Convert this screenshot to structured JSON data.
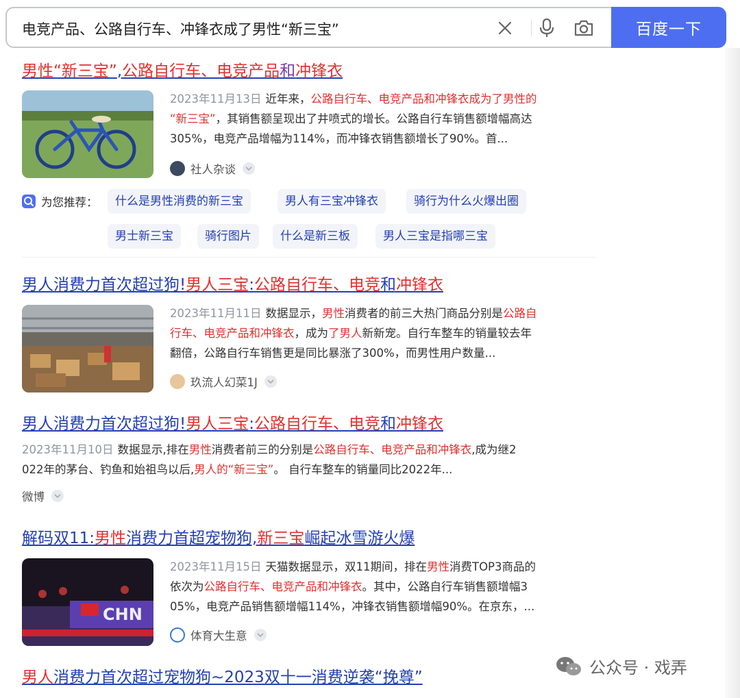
{
  "search": {
    "query": "电竞产品、公路自行车、冲锋衣成了男性“新三宝”",
    "button_label": "百度一下"
  },
  "results": [
    {
      "title_parts": [
        {
          "t": "男性“新三宝”",
          "c": "hl"
        },
        {
          "t": ",",
          "c": ""
        },
        {
          "t": "公路自行车、电竞产品",
          "c": "hl"
        },
        {
          "t": "和",
          "c": "vis"
        },
        {
          "t": "冲锋衣",
          "c": "hl"
        }
      ],
      "date": "2023年11月13日",
      "snippet_lines": [
        [
          {
            "t": "近年来，",
            "c": ""
          },
          {
            "t": "公路自行车、电竞产品和冲锋衣成为了男性的",
            "c": "hl"
          }
        ],
        [
          {
            "t": "“新三宝”",
            "c": "hl"
          },
          {
            "t": "，其销售额呈现出了井喷式的增长。公路自行车销售额增幅高达",
            "c": ""
          }
        ],
        [
          {
            "t": "305%，电竞产品增幅为114%，而冲锋衣销售额增长了90%。首...",
            "c": ""
          }
        ]
      ],
      "source": "社人杂谈"
    },
    {
      "title_parts": [
        {
          "t": "男人消费力首次超过狗!",
          "c": ""
        },
        {
          "t": "男人三宝",
          "c": "hl"
        },
        {
          "t": ":",
          "c": ""
        },
        {
          "t": "公路自行车、电竞",
          "c": "hl"
        },
        {
          "t": "和",
          "c": ""
        },
        {
          "t": "冲锋衣",
          "c": "hl"
        }
      ],
      "date": "2023年11月11日",
      "snippet_lines": [
        [
          {
            "t": "数据显示，",
            "c": ""
          },
          {
            "t": "男性",
            "c": "hl"
          },
          {
            "t": "消费者的前三大热门商品分别是",
            "c": ""
          },
          {
            "t": "公路自",
            "c": "hl"
          }
        ],
        [
          {
            "t": "行车、电竞产品和冲锋衣",
            "c": "hl"
          },
          {
            "t": "，成为",
            "c": ""
          },
          {
            "t": "了男人",
            "c": "hl"
          },
          {
            "t": "新新宠。自行车整车的销量较去年",
            "c": ""
          }
        ],
        [
          {
            "t": "翻倍，公路自行车销售更是同比暴涨了300%，而男性用户数量...",
            "c": ""
          }
        ]
      ],
      "source": "玖流人幻菜1J"
    },
    {
      "title_parts": [
        {
          "t": "男人消费力首次超过狗!",
          "c": ""
        },
        {
          "t": "男人三宝",
          "c": "hl"
        },
        {
          "t": ":",
          "c": ""
        },
        {
          "t": "公路自行车、电竞",
          "c": "hl"
        },
        {
          "t": "和",
          "c": ""
        },
        {
          "t": "冲锋衣",
          "c": "hl"
        }
      ],
      "date": "2023年11月10日",
      "snippet_lines": [
        [
          {
            "t": "数据显示,排在",
            "c": ""
          },
          {
            "t": "男性",
            "c": "hl"
          },
          {
            "t": "消费者前三的分别是",
            "c": ""
          },
          {
            "t": "公路自行车、电竞产品和冲锋衣",
            "c": "hl"
          },
          {
            "t": ",成为继2",
            "c": ""
          }
        ],
        [
          {
            "t": "022年的茅台、钓鱼和始祖鸟以后,",
            "c": ""
          },
          {
            "t": "男人的“新三宝”",
            "c": "hl"
          },
          {
            "t": "。 自行车整车的销量同比2022年...",
            "c": ""
          }
        ]
      ],
      "source": "微博"
    },
    {
      "title_parts": [
        {
          "t": "解码双11:",
          "c": ""
        },
        {
          "t": "男性",
          "c": "hl"
        },
        {
          "t": "消费力首超宠物狗,",
          "c": ""
        },
        {
          "t": "新三宝",
          "c": "hl"
        },
        {
          "t": "崛起冰雪游火爆",
          "c": ""
        }
      ],
      "date": "2023年11月15日",
      "snippet_lines": [
        [
          {
            "t": "天猫数据显示，双11期间，排在",
            "c": ""
          },
          {
            "t": "男性",
            "c": "hl"
          },
          {
            "t": "消费TOP3商品的",
            "c": ""
          }
        ],
        [
          {
            "t": "依次为",
            "c": ""
          },
          {
            "t": "公路自行车、电竞产品和冲锋衣",
            "c": "hl"
          },
          {
            "t": "。其中，公路自行车销售额增幅3",
            "c": ""
          }
        ],
        [
          {
            "t": "05%，电竞产品销售额增幅114%，冲锋衣销售额增幅90%。在京东，...",
            "c": ""
          }
        ]
      ],
      "source": "体育大生意"
    },
    {
      "title_parts": [
        {
          "t": "男人",
          "c": "hl"
        },
        {
          "t": "消费力首次超过宠物狗~2023双十一消费逆袭“挽尊”",
          "c": ""
        }
      ]
    }
  ],
  "recommend": {
    "label": "为您推荐：",
    "tags": [
      "什么是男性消费的新三宝",
      "男人有三宝冲锋衣",
      "骑行为什么火爆出圈",
      "男士新三宝",
      "骑行图片",
      "什么是新三板",
      "男人三宝是指哪三宝"
    ]
  },
  "watermark": "公众号 · 戏弄",
  "colors": {
    "accent": "#4e6ef2",
    "link": "#2440b3",
    "highlight": "#e0312f"
  },
  "icons": [
    "clear-icon",
    "microphone-icon",
    "camera-icon",
    "recommend-icon",
    "more-icon",
    "wechat-icon"
  ]
}
